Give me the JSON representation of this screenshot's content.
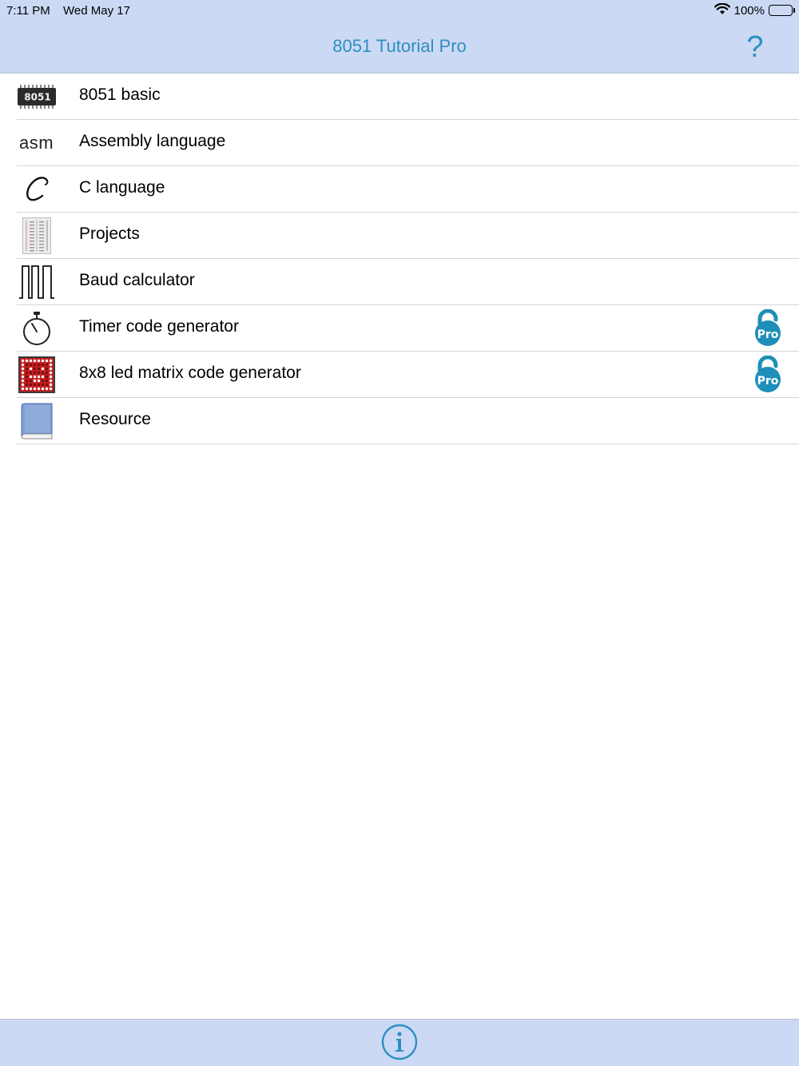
{
  "status_bar": {
    "time": "7:11 PM",
    "date": "Wed May 17",
    "battery": "100%"
  },
  "nav": {
    "title": "8051 Tutorial Pro",
    "help_label": "?"
  },
  "menu": {
    "items": [
      {
        "label": "8051 basic",
        "icon": "chip-8051-icon",
        "chip_text": "8051",
        "locked": false
      },
      {
        "label": "Assembly language",
        "icon": "asm-icon",
        "icon_text": "asm",
        "locked": false
      },
      {
        "label": "C language",
        "icon": "c-letter-icon",
        "locked": false
      },
      {
        "label": "Projects",
        "icon": "breadboard-icon",
        "locked": false
      },
      {
        "label": "Baud calculator",
        "icon": "square-wave-icon",
        "locked": false
      },
      {
        "label": "Timer code generator",
        "icon": "stopwatch-icon",
        "locked": true
      },
      {
        "label": "8x8 led matrix code generator",
        "icon": "led-matrix-icon",
        "locked": true
      },
      {
        "label": "Resource",
        "icon": "book-icon",
        "locked": false
      }
    ],
    "pro_badge_text": "Pro"
  },
  "colors": {
    "bar_background": "#ccd9f4",
    "accent": "#2d8fc0",
    "pro_badge": "#1e8fb8"
  },
  "toolbar": {
    "info_icon": "info-icon"
  }
}
